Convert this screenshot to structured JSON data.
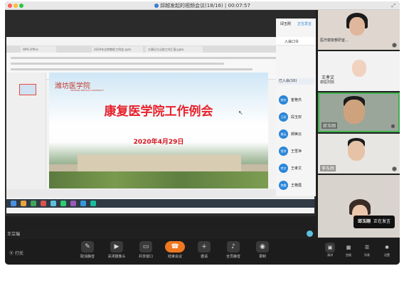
{
  "window": {
    "title": "邱越发起的视频会议(18/16) | 00:07:57"
  },
  "share": {
    "browser_tabs": [
      "WPS Office",
      "2020年全院教职工例会.pptx",
      "大事记与当前工作汇报.pptx"
    ],
    "slide": {
      "logo_text": "潍坊医学院",
      "logo_sub": "WEIFANG MEDICAL UNIVERSITY",
      "title": "康复医学院工作例会",
      "date": "2020年4月29日"
    },
    "speaker_name": "王立瑞"
  },
  "participant_list": {
    "host_name": "邱玉刚",
    "host_status": "正在发言",
    "invite_label": "入会口令",
    "joined_label": "已入会(16)",
    "members": [
      {
        "avatar": "艳杰",
        "name": "崔艳杰"
      },
      {
        "avatar": "玉双",
        "name": "段玉双"
      },
      {
        "avatar": "美云",
        "name": "郝美云"
      },
      {
        "avatar": "雪净",
        "name": "王雪净"
      },
      {
        "avatar": "孝文",
        "name": "王孝文"
      },
      {
        "avatar": "艳霞",
        "name": "王艳霞"
      }
    ]
  },
  "video_tiles": [
    {
      "name": "邱玉刚",
      "status": "正在发言",
      "sub": "医疗康复教研室..."
    },
    {
      "name": "王孝文",
      "sub": "康医附院"
    },
    {
      "name": "邱玉刚"
    },
    {
      "name": "李东辉"
    },
    {
      "name": ""
    }
  ],
  "active_speaker_bubble": {
    "name": "邱玉刚",
    "status": "正在发言"
  },
  "toolbar": {
    "left_label": "打扰",
    "buttons": [
      {
        "icon": "mic-off-icon",
        "glyph": "✎",
        "label": "取消静音"
      },
      {
        "icon": "camera-icon",
        "glyph": "▶",
        "label": "关闭摄像头"
      },
      {
        "icon": "share-screen-icon",
        "glyph": "▭",
        "label": "共享窗口"
      },
      {
        "icon": "end-call-icon",
        "glyph": "☎",
        "label": "结束会议"
      },
      {
        "icon": "invite-icon",
        "glyph": "+",
        "label": "邀请"
      },
      {
        "icon": "mute-all-icon",
        "glyph": "♪",
        "label": "全员静音"
      },
      {
        "icon": "record-icon",
        "glyph": "◉",
        "label": "录制"
      }
    ],
    "right_buttons": [
      {
        "icon": "speaker-view-icon",
        "glyph": "▣",
        "label": "演讲"
      },
      {
        "icon": "gallery-view-icon",
        "glyph": "▦",
        "label": "宫格"
      },
      {
        "icon": "list-view-icon",
        "glyph": "☰",
        "label": "列表"
      },
      {
        "icon": "settings-icon",
        "glyph": "✱",
        "label": "设置"
      }
    ]
  }
}
